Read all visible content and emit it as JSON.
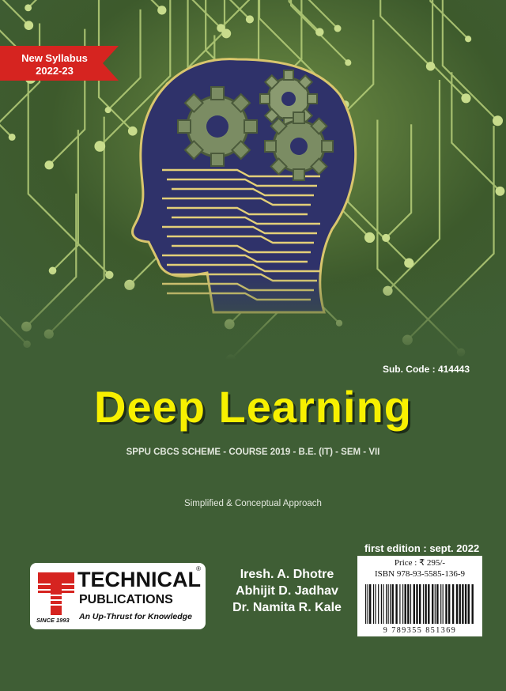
{
  "ribbon": {
    "line1": "New Syllabus",
    "line2": "2022-23"
  },
  "book": {
    "sub_code": "Sub. Code : 414443",
    "title": "Deep Learning",
    "scheme": "SPPU CBCS SCHEME - COURSE 2019 - B.E. (IT) - SEM - VII",
    "approach": "Simplified & Conceptual Approach",
    "edition": "first edition : sept. 2022"
  },
  "publisher": {
    "name_line1": "TECHNICAL",
    "name_line2": "PUBLICATIONS",
    "tagline": "An Up-Thrust for Knowledge",
    "since": "SINCE 1993",
    "registered": "®"
  },
  "authors": [
    "Iresh. A. Dhotre",
    "Abhijit D. Jadhav",
    "Dr. Namita R. Kale"
  ],
  "price_box": {
    "price": "Price : ₹ 295/-",
    "isbn": "ISBN 978-93-5585-136-9",
    "barcode_digits": "9 789355 851369"
  },
  "colors": {
    "background": "#3f5e35",
    "title": "#f7f000",
    "ribbon": "#d62420",
    "circuit": "#a8c46a",
    "head_fill": "#3a3f7a"
  },
  "icons": [
    "circuit-head-illustration",
    "gear-icon",
    "technical-publications-logo",
    "barcode"
  ]
}
